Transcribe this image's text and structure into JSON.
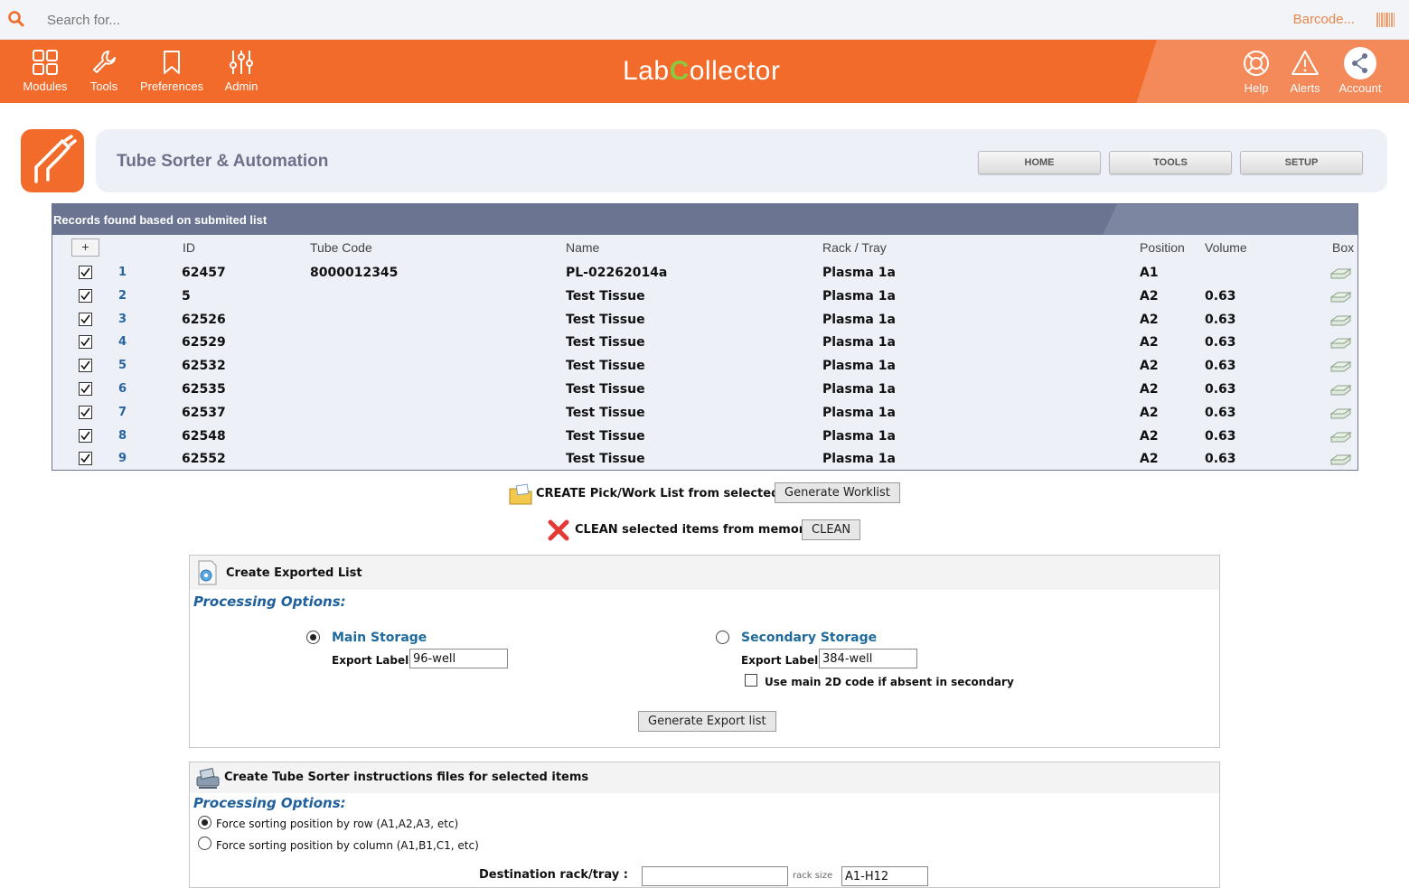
{
  "topbar": {
    "search_placeholder": "Search for...",
    "barcode_label": "Barcode..."
  },
  "nav": {
    "left": [
      {
        "label": "Modules",
        "icon": "modules-icon"
      },
      {
        "label": "Tools",
        "icon": "wrench-icon"
      },
      {
        "label": "Preferences",
        "icon": "bookmark-icon"
      },
      {
        "label": "Admin",
        "icon": "sliders-icon"
      }
    ],
    "right": [
      {
        "label": "Help",
        "icon": "lifebuoy-icon"
      },
      {
        "label": "Alerts",
        "icon": "warning-icon"
      },
      {
        "label": "Account",
        "icon": "share-icon"
      }
    ],
    "logo_part1": "Lab",
    "logo_part2": "C",
    "logo_part3": "ollector"
  },
  "module": {
    "title": "Tube Sorter & Automation",
    "buttons": [
      "HOME",
      "TOOLS",
      "SETUP"
    ]
  },
  "records": {
    "title": "Records found based on submited list",
    "plus": "+",
    "columns": [
      "ID",
      "Tube Code",
      "Name",
      "Rack / Tray",
      "Position",
      "Volume",
      "Box"
    ],
    "rows": [
      {
        "n": "1",
        "id": "62457",
        "tube": "8000012345",
        "name": "PL-02262014a",
        "rack": "Plasma 1a",
        "pos": "A1",
        "vol": ""
      },
      {
        "n": "2",
        "id": "5",
        "tube": "",
        "name": "Test Tissue",
        "rack": "Plasma 1a",
        "pos": "A2",
        "vol": "0.63"
      },
      {
        "n": "3",
        "id": "62526",
        "tube": "",
        "name": "Test Tissue",
        "rack": "Plasma 1a",
        "pos": "A2",
        "vol": "0.63"
      },
      {
        "n": "4",
        "id": "62529",
        "tube": "",
        "name": "Test Tissue",
        "rack": "Plasma 1a",
        "pos": "A2",
        "vol": "0.63"
      },
      {
        "n": "5",
        "id": "62532",
        "tube": "",
        "name": "Test Tissue",
        "rack": "Plasma 1a",
        "pos": "A2",
        "vol": "0.63"
      },
      {
        "n": "6",
        "id": "62535",
        "tube": "",
        "name": "Test Tissue",
        "rack": "Plasma 1a",
        "pos": "A2",
        "vol": "0.63"
      },
      {
        "n": "7",
        "id": "62537",
        "tube": "",
        "name": "Test Tissue",
        "rack": "Plasma 1a",
        "pos": "A2",
        "vol": "0.63"
      },
      {
        "n": "8",
        "id": "62548",
        "tube": "",
        "name": "Test Tissue",
        "rack": "Plasma 1a",
        "pos": "A2",
        "vol": "0.63"
      },
      {
        "n": "9",
        "id": "62552",
        "tube": "",
        "name": "Test Tissue",
        "rack": "Plasma 1a",
        "pos": "A2",
        "vol": "0.63"
      }
    ]
  },
  "actions": {
    "create_label": "CREATE Pick/Work List from selected:",
    "create_button": "Generate Worklist",
    "clean_label": "CLEAN selected items from memory:",
    "clean_button": "CLEAN"
  },
  "export_panel": {
    "title": "Create Exported List",
    "processing": "Processing Options:",
    "main_storage": "Main Storage",
    "secondary_storage": "Secondary Storage",
    "export_label": "Export Label:",
    "main_value": "96-well",
    "secondary_value": "384-well",
    "use_main_2d": "Use main 2D code if absent in secondary",
    "generate_button": "Generate Export list"
  },
  "sorter_panel": {
    "title": "Create Tube Sorter instructions files for selected items",
    "processing": "Processing Options:",
    "by_row": "Force sorting position by row (A1,A2,A3, etc)",
    "by_column": "Force sorting position by column (A1,B1,C1, etc)",
    "destination": "Destination rack/tray :",
    "rack_size_label": "rack size",
    "rack_size_value": "A1-H12"
  }
}
